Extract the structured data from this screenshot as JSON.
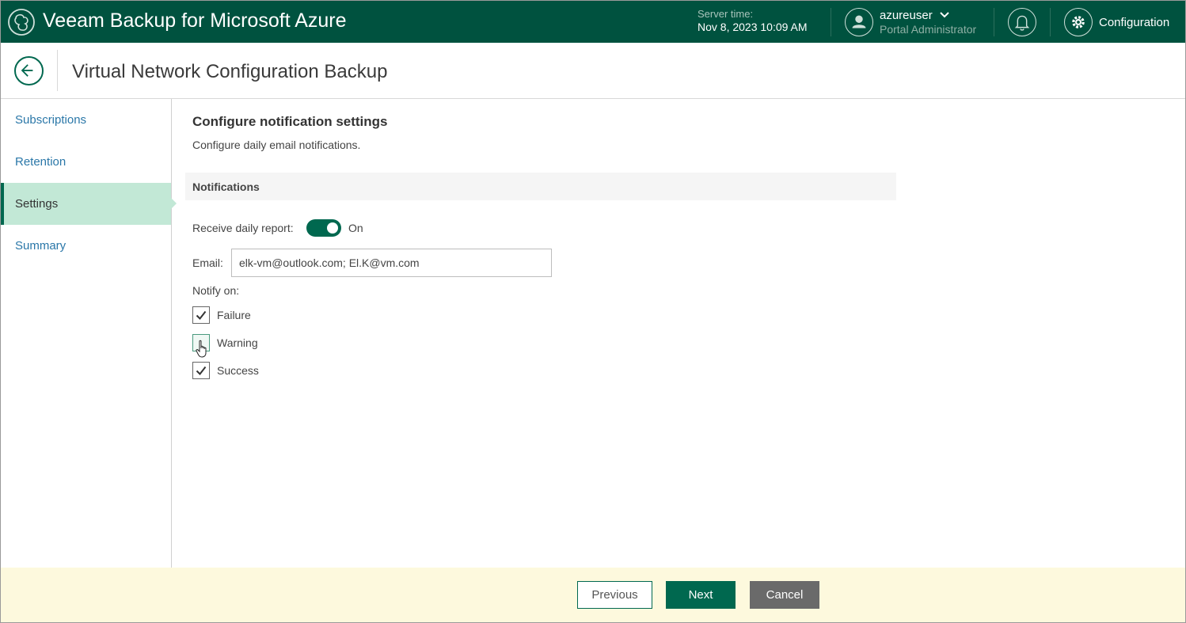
{
  "app": {
    "title": "Veeam Backup for Microsoft Azure",
    "logo_icon": "veeam-cloud-logo-icon"
  },
  "header": {
    "server_time_label": "Server time:",
    "server_time_value": "Nov 8, 2023 10:09 AM",
    "user_name": "azureuser",
    "user_role": "Portal Administrator",
    "configuration_label": "Configuration",
    "icons": [
      "user-avatar-icon",
      "chevron-down-icon",
      "bell-icon",
      "gear-icon"
    ]
  },
  "page": {
    "title": "Virtual Network Configuration Backup",
    "back_icon": "arrow-left-icon"
  },
  "nav": {
    "items": [
      {
        "label": "Subscriptions",
        "active": false
      },
      {
        "label": "Retention",
        "active": false
      },
      {
        "label": "Settings",
        "active": true
      },
      {
        "label": "Summary",
        "active": false
      }
    ]
  },
  "content": {
    "title": "Configure notification settings",
    "description": "Configure daily email notifications.",
    "group_title": "Notifications",
    "daily_report_label": "Receive daily report:",
    "daily_report_state": "On",
    "email_label": "Email:",
    "email_value": "elk-vm@outlook.com; El.K@vm.com",
    "notify_on_label": "Notify on:",
    "options": [
      {
        "label": "Failure",
        "checked": true
      },
      {
        "label": "Warning",
        "checked": false
      },
      {
        "label": "Success",
        "checked": true
      }
    ]
  },
  "footer": {
    "previous_label": "Previous",
    "next_label": "Next",
    "cancel_label": "Cancel"
  },
  "colors": {
    "brand_green": "#00523f",
    "accent_green": "#00684f",
    "active_nav_bg": "#c2e8d6",
    "link_blue": "#2a77a8",
    "footer_bg": "#fdf9dd",
    "cancel_gray": "#6a6a6a"
  }
}
